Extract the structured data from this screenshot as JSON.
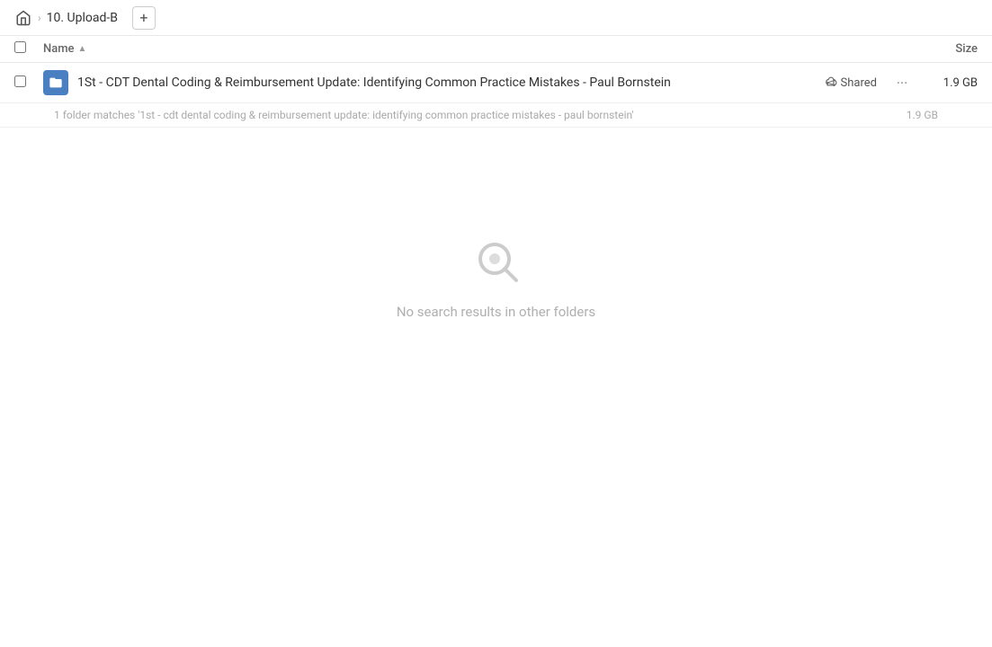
{
  "topbar": {
    "home_icon_label": "home",
    "breadcrumb": [
      {
        "label": "10. Upload-B"
      }
    ],
    "add_button_label": "+"
  },
  "columns": {
    "name_label": "Name",
    "sort_arrow": "▲",
    "size_label": "Size"
  },
  "file_row": {
    "file_name": "1St - CDT Dental Coding & Reimbursement Update: Identifying Common Practice Mistakes - Paul Bornstein",
    "shared_label": "Shared",
    "more_label": "...",
    "file_size": "1.9 GB"
  },
  "match_info": {
    "text": "1 folder matches '1st - cdt dental coding & reimbursement update: identifying common practice mistakes - paul bornstein'",
    "size": "1.9 GB"
  },
  "empty_state": {
    "message": "No search results in other folders"
  }
}
